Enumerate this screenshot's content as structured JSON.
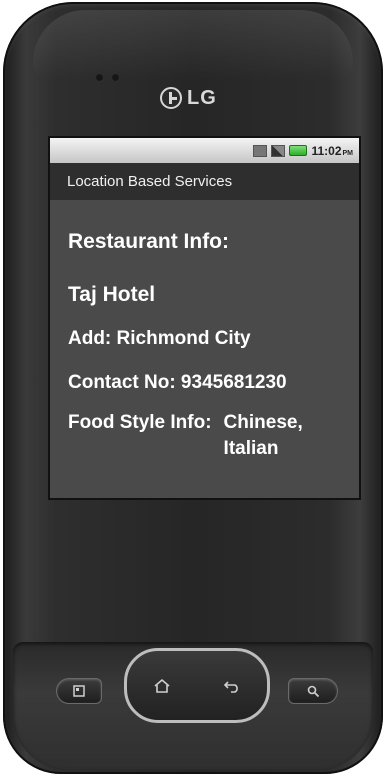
{
  "device": {
    "brand": "LG",
    "icons": [
      "lg-logo-icon",
      "menu-icon",
      "home-icon",
      "back-icon",
      "search-icon"
    ]
  },
  "status_bar": {
    "time": "11:02",
    "ampm": "PM",
    "icons": [
      "sim-icon",
      "signal-icon",
      "battery-icon"
    ],
    "battery_color": "#2fae2a"
  },
  "app": {
    "title": "Location Based Services"
  },
  "restaurant": {
    "heading": "Restaurant Info:",
    "name": "Taj Hotel",
    "address": "Add: Richmond City",
    "contact": "Contact No: 9345681230",
    "food_style_label": "Food Style Info:",
    "food_style_value": "Chinese, Italian"
  },
  "colors": {
    "screen_background": "#4a4a4a",
    "title_bar_background": "#2e2e2e",
    "text": "#ffffff"
  }
}
